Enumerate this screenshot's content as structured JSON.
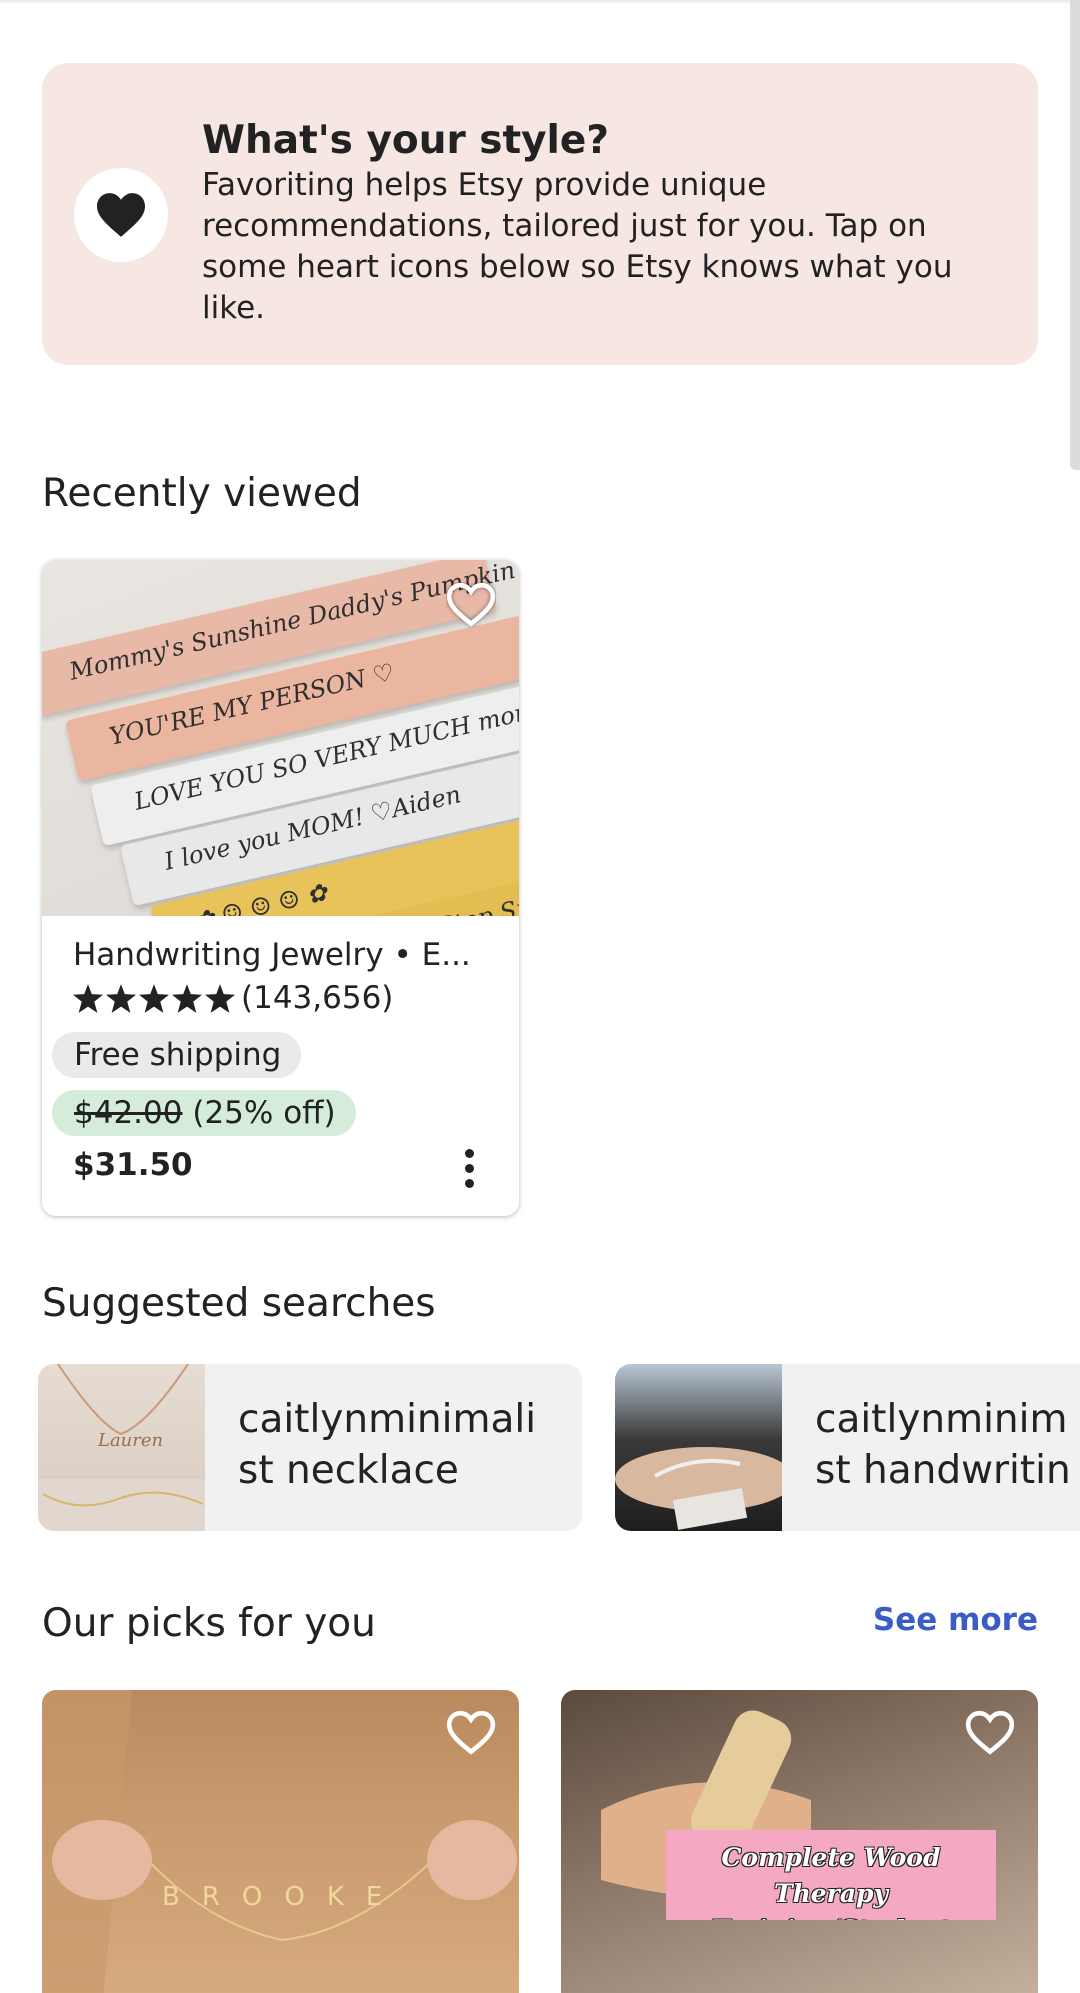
{
  "style_prompt": {
    "title": "What's your style?",
    "body": "Favoriting helps Etsy provide unique recommendations, tailored just for you. Tap on some heart icons below so Etsy knows what you like.",
    "icon": "heart-icon"
  },
  "recently_viewed": {
    "title": "Recently viewed",
    "item": {
      "title": "Handwriting Jewelry • E...",
      "rating_stars": 5,
      "review_count": "(143,656)",
      "shipping_badge": "Free shipping",
      "original_price": "$42.00",
      "discount": "(25% off)",
      "price": "$31.50",
      "image_lines": [
        "Mommy's Sunshine Daddy's Pumpkin",
        "YOU'RE MY PERSON ♡",
        "LOVE YOU SO VERY MUCH mom",
        "I love you MOM! ♡Aiden",
        "✿ ☺ ☺ ☺ ✿",
        "P.S. Never Stop Sparklin"
      ]
    }
  },
  "suggested_searches": {
    "title": "Suggested searches",
    "items": [
      {
        "label": "caitlynminimali\nst necklace",
        "thumb_text": "Lauren"
      },
      {
        "label": "caitlynminim\nst handwritin",
        "thumb_text": ""
      }
    ]
  },
  "picks": {
    "title": "Our picks for you",
    "see_more": "See more",
    "items": [
      {
        "image_text": "BROOKE"
      },
      {
        "image_text": "Complete Wood Therapy Training/Student Manual"
      }
    ]
  },
  "colors": {
    "style_card_bg": "#f6e7e3",
    "sale_badge_bg": "#d4ecd9",
    "link": "#3b5cc4"
  }
}
